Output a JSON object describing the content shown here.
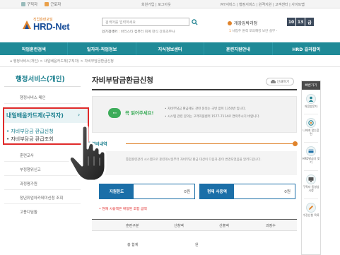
{
  "util": {
    "links": [
      "구직자",
      "근로자"
    ],
    "center": "회원가입 | 로그아웃",
    "right": "MY서비스 | 행정서비스 | 원격지원 | 고객센터 | 사이트맵"
  },
  "logo": {
    "sub": "직업훈련포털",
    "main": "HRD-Net"
  },
  "search": {
    "placeholder": "검색어를 입력하세요",
    "popular_label": "인기검색어",
    "popular_terms": "바리스타 컴퓨터 회계 한식 간호조무사"
  },
  "course": {
    "title": "개강임박과정",
    "counts": [
      "10",
      "13",
      "급"
    ],
    "subtitle_prefix": "1",
    "subtitle": "사업주 원격 모의해킹 보안 실무 -"
  },
  "nav": [
    "직업훈련검색",
    "일자리-직업정보",
    "지식정보센터",
    "훈련지원안내",
    "HRD 길라잡이"
  ],
  "breadcrumb": "⌂  행정서비스(개인)  >  내일배움카드제(구직자)  >  자비부담금환급신청",
  "sidebar": {
    "title": "행정서비스(개인)",
    "items": [
      {
        "label": "행정서비스 메인"
      },
      {
        "label": "훈련교사"
      },
      {
        "label": "부정행위신고"
      },
      {
        "label": "과정평가원"
      },
      {
        "label": "청년취업아카데미신청 조회"
      },
      {
        "label": "고용디딤돌"
      }
    ],
    "highlight": {
      "title": "내일배움카드제(구직자)",
      "chevron": "›",
      "sub1": "• 자비부담금 환급신청",
      "sub2": "• 자비부담금 환급조회"
    }
  },
  "main": {
    "title": "자비부담금환급신청",
    "print": "인쇄하기",
    "notice": {
      "bubble": "···",
      "head": "꼭 읽어주세요!",
      "line1": "• 자비부담금 환급제도 관련 문의는 국번 없이 1350번 입니다.",
      "line2": "• 시스템 관련 문의는 고객지원센터 1577-7114로 연락주시기 바랍니다."
    },
    "section": "훈련비내역",
    "info": "통합훈련관리 시스템으로 훈련개시일부터 자비부담 환급 대상이 다음과 같이 변경되었음을 알려드립니다.",
    "stats": [
      {
        "label": "지원한도",
        "value": "0원"
      },
      {
        "label": "현재 사용액",
        "value": "0원"
      }
    ],
    "warning": "• 현재 사용액은 확정된 조합 금액",
    "table": {
      "headers": [
        "훈련구분",
        "신청액",
        "산출액",
        "과정수"
      ],
      "row": [
        "총 합계",
        "원",
        "",
        ""
      ]
    }
  },
  "quick": {
    "head": "빠른가기",
    "items": [
      "처음방문자",
      "나에게 맞는훈련",
      "HRD발급기 찾기",
      "구직자 동영상시청",
      "수강신청 목록"
    ]
  },
  "colors": {
    "teal": "#1f8a97",
    "red": "#e02a2a",
    "orange": "#e0832b",
    "blue": "#1b6fa8",
    "green": "#3dac5a"
  }
}
